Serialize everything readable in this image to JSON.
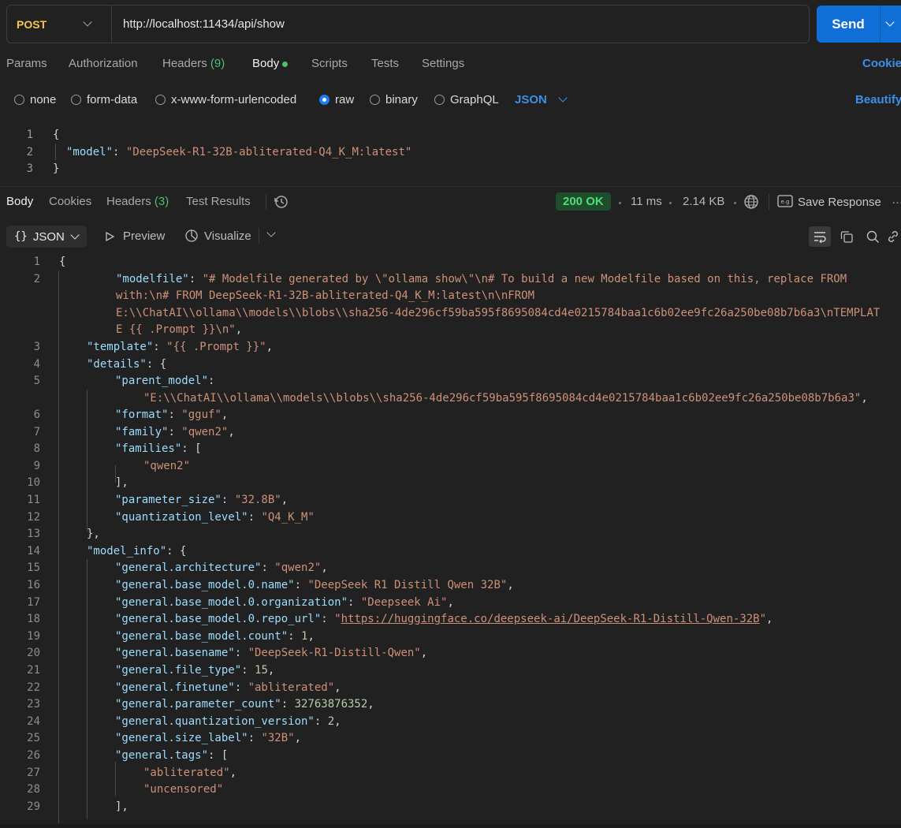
{
  "request": {
    "method": "POST",
    "url": "http://localhost:11434/api/show",
    "send_label": "Send"
  },
  "request_tabs": {
    "params": "Params",
    "authorization": "Authorization",
    "headers": "Headers",
    "headers_count": "(9)",
    "body": "Body",
    "scripts": "Scripts",
    "tests": "Tests",
    "settings": "Settings",
    "cookies": "Cookie"
  },
  "body_types": {
    "none": "none",
    "form_data": "form-data",
    "urlencoded": "x-www-form-urlencoded",
    "raw": "raw",
    "binary": "binary",
    "graphql": "GraphQL",
    "format": "JSON",
    "beautify": "Beautify"
  },
  "request_body": {
    "line_numbers": [
      "1",
      "2",
      "3"
    ],
    "open": "{",
    "key": "\"model\"",
    "colon": ": ",
    "value": "\"DeepSeek-R1-32B-abliterated-Q4_K_M:latest\"",
    "close": "}"
  },
  "response_tabs": {
    "body": "Body",
    "cookies": "Cookies",
    "headers": "Headers",
    "headers_count": "(3)",
    "test_results": "Test Results",
    "status": "200 OK",
    "time": "11 ms",
    "size": "2.14 KB",
    "save_response": "Save Response"
  },
  "view_toolbar": {
    "format_label": "JSON",
    "preview": "Preview",
    "visualize": "Visualize"
  },
  "response_lines": [
    {
      "ln": "1",
      "t": [
        {
          "c": "p",
          "v": "{"
        }
      ]
    },
    {
      "ln": "2",
      "t": [
        {
          "c": "k",
          "v": "\"modelfile\""
        },
        {
          "c": "p",
          "v": ": "
        },
        {
          "c": "s",
          "v": "\"# Modelfile generated by \\\"ollama show\\\"\\n# To build a new Modelfile based on this, replace FROM"
        }
      ]
    },
    {
      "ln": "",
      "t": [
        {
          "c": "s",
          "v": "with:\\n# FROM DeepSeek-R1-32B-abliterated-Q4_K_M:latest\\n\\nFROM"
        }
      ]
    },
    {
      "ln": "",
      "t": [
        {
          "c": "s",
          "v": "E:\\\\ChatAI\\\\ollama\\\\models\\\\blobs\\\\sha256-4de296cf59ba595f8695084cd4e0215784baa1c6b02ee9fc26a250be08b7b6a3\\nTEMPLAT"
        }
      ]
    },
    {
      "ln": "",
      "t": [
        {
          "c": "s",
          "v": "E {{ .Prompt }}\\n\""
        },
        {
          "c": "p",
          "v": ","
        }
      ]
    },
    {
      "ln": "3",
      "t": [
        {
          "c": "k",
          "v": "\"template\""
        },
        {
          "c": "p",
          "v": ": "
        },
        {
          "c": "s",
          "v": "\"{{ .Prompt }}\""
        },
        {
          "c": "p",
          "v": ","
        }
      ]
    },
    {
      "ln": "4",
      "t": [
        {
          "c": "k",
          "v": "\"details\""
        },
        {
          "c": "p",
          "v": ": {"
        }
      ]
    },
    {
      "ln": "5",
      "t": [
        {
          "c": "k",
          "v": "\"parent_model\""
        },
        {
          "c": "p",
          "v": ":"
        }
      ]
    },
    {
      "ln": "",
      "t": [
        {
          "c": "s",
          "v": "\"E:\\\\ChatAI\\\\ollama\\\\models\\\\blobs\\\\sha256-4de296cf59ba595f8695084cd4e0215784baa1c6b02ee9fc26a250be08b7b6a3\""
        },
        {
          "c": "p",
          "v": ","
        }
      ]
    },
    {
      "ln": "6",
      "t": [
        {
          "c": "k",
          "v": "\"format\""
        },
        {
          "c": "p",
          "v": ": "
        },
        {
          "c": "s",
          "v": "\"gguf\""
        },
        {
          "c": "p",
          "v": ","
        }
      ]
    },
    {
      "ln": "7",
      "t": [
        {
          "c": "k",
          "v": "\"family\""
        },
        {
          "c": "p",
          "v": ": "
        },
        {
          "c": "s",
          "v": "\"qwen2\""
        },
        {
          "c": "p",
          "v": ","
        }
      ]
    },
    {
      "ln": "8",
      "t": [
        {
          "c": "k",
          "v": "\"families\""
        },
        {
          "c": "p",
          "v": ": ["
        }
      ]
    },
    {
      "ln": "9",
      "t": [
        {
          "c": "s",
          "v": "\"qwen2\""
        }
      ]
    },
    {
      "ln": "10",
      "t": [
        {
          "c": "p",
          "v": "],"
        }
      ]
    },
    {
      "ln": "11",
      "t": [
        {
          "c": "k",
          "v": "\"parameter_size\""
        },
        {
          "c": "p",
          "v": ": "
        },
        {
          "c": "s",
          "v": "\"32.8B\""
        },
        {
          "c": "p",
          "v": ","
        }
      ]
    },
    {
      "ln": "12",
      "t": [
        {
          "c": "k",
          "v": "\"quantization_level\""
        },
        {
          "c": "p",
          "v": ": "
        },
        {
          "c": "s",
          "v": "\"Q4_K_M\""
        }
      ]
    },
    {
      "ln": "13",
      "t": [
        {
          "c": "p",
          "v": "},"
        }
      ]
    },
    {
      "ln": "14",
      "t": [
        {
          "c": "k",
          "v": "\"model_info\""
        },
        {
          "c": "p",
          "v": ": {"
        }
      ]
    },
    {
      "ln": "15",
      "t": [
        {
          "c": "k",
          "v": "\"general.architecture\""
        },
        {
          "c": "p",
          "v": ": "
        },
        {
          "c": "s",
          "v": "\"qwen2\""
        },
        {
          "c": "p",
          "v": ","
        }
      ]
    },
    {
      "ln": "16",
      "t": [
        {
          "c": "k",
          "v": "\"general.base_model.0.name\""
        },
        {
          "c": "p",
          "v": ": "
        },
        {
          "c": "s",
          "v": "\"DeepSeek R1 Distill Qwen 32B\""
        },
        {
          "c": "p",
          "v": ","
        }
      ]
    },
    {
      "ln": "17",
      "t": [
        {
          "c": "k",
          "v": "\"general.base_model.0.organization\""
        },
        {
          "c": "p",
          "v": ": "
        },
        {
          "c": "s",
          "v": "\"Deepseek Ai\""
        },
        {
          "c": "p",
          "v": ","
        }
      ]
    },
    {
      "ln": "18",
      "t": [
        {
          "c": "k",
          "v": "\"general.base_model.0.repo_url\""
        },
        {
          "c": "p",
          "v": ": "
        },
        {
          "c": "s",
          "v": "\""
        },
        {
          "c": "u",
          "v": "https://huggingface.co/deepseek-ai/DeepSeek-R1-Distill-Qwen-32B"
        },
        {
          "c": "s",
          "v": "\""
        },
        {
          "c": "p",
          "v": ","
        }
      ]
    },
    {
      "ln": "19",
      "t": [
        {
          "c": "k",
          "v": "\"general.base_model.count\""
        },
        {
          "c": "p",
          "v": ": "
        },
        {
          "c": "n",
          "v": "1"
        },
        {
          "c": "p",
          "v": ","
        }
      ]
    },
    {
      "ln": "20",
      "t": [
        {
          "c": "k",
          "v": "\"general.basename\""
        },
        {
          "c": "p",
          "v": ": "
        },
        {
          "c": "s",
          "v": "\"DeepSeek-R1-Distill-Qwen\""
        },
        {
          "c": "p",
          "v": ","
        }
      ]
    },
    {
      "ln": "21",
      "t": [
        {
          "c": "k",
          "v": "\"general.file_type\""
        },
        {
          "c": "p",
          "v": ": "
        },
        {
          "c": "n",
          "v": "15"
        },
        {
          "c": "p",
          "v": ","
        }
      ]
    },
    {
      "ln": "22",
      "t": [
        {
          "c": "k",
          "v": "\"general.finetune\""
        },
        {
          "c": "p",
          "v": ": "
        },
        {
          "c": "s",
          "v": "\"abliterated\""
        },
        {
          "c": "p",
          "v": ","
        }
      ]
    },
    {
      "ln": "23",
      "t": [
        {
          "c": "k",
          "v": "\"general.parameter_count\""
        },
        {
          "c": "p",
          "v": ": "
        },
        {
          "c": "n",
          "v": "32763876352"
        },
        {
          "c": "p",
          "v": ","
        }
      ]
    },
    {
      "ln": "24",
      "t": [
        {
          "c": "k",
          "v": "\"general.quantization_version\""
        },
        {
          "c": "p",
          "v": ": "
        },
        {
          "c": "n",
          "v": "2"
        },
        {
          "c": "p",
          "v": ","
        }
      ]
    },
    {
      "ln": "25",
      "t": [
        {
          "c": "k",
          "v": "\"general.size_label\""
        },
        {
          "c": "p",
          "v": ": "
        },
        {
          "c": "s",
          "v": "\"32B\""
        },
        {
          "c": "p",
          "v": ","
        }
      ]
    },
    {
      "ln": "26",
      "t": [
        {
          "c": "k",
          "v": "\"general.tags\""
        },
        {
          "c": "p",
          "v": ": ["
        }
      ]
    },
    {
      "ln": "27",
      "t": [
        {
          "c": "s",
          "v": "\"abliterated\""
        },
        {
          "c": "p",
          "v": ","
        }
      ]
    },
    {
      "ln": "28",
      "t": [
        {
          "c": "s",
          "v": "\"uncensored\""
        }
      ]
    },
    {
      "ln": "29",
      "t": [
        {
          "c": "p",
          "v": "],"
        }
      ]
    }
  ]
}
